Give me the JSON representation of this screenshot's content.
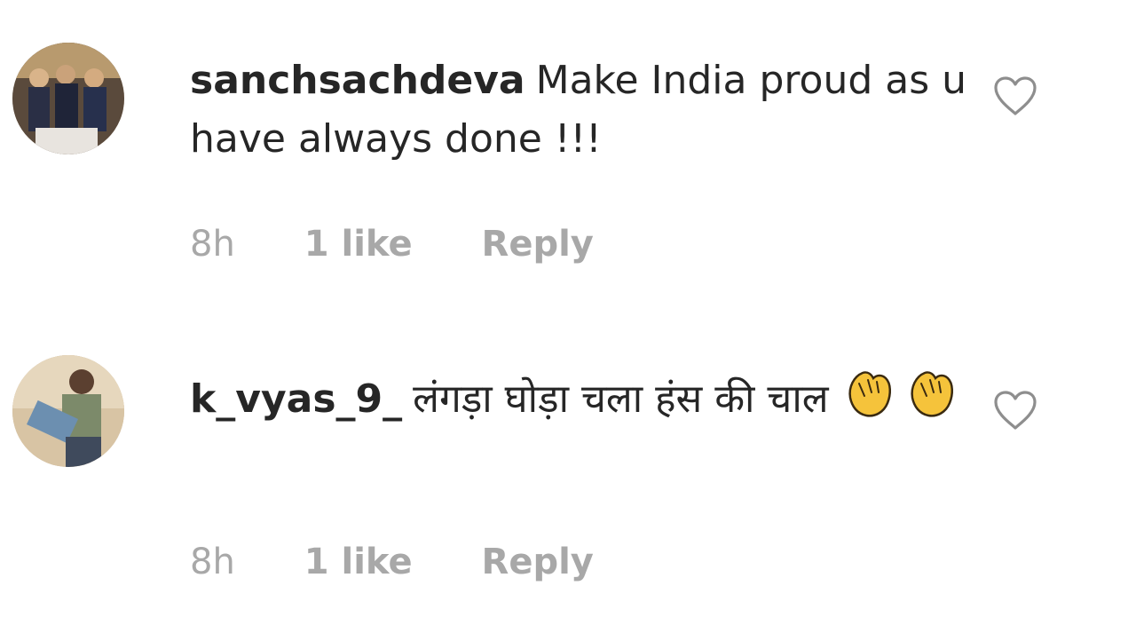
{
  "comments": [
    {
      "username": "sanchsachdeva",
      "text": "Make India proud as u have always done !!!",
      "time": "8h",
      "likes": "1 like",
      "reply": "Reply",
      "avatar_icon": "group-photo-avatar",
      "like_icon": "heart-outline-icon"
    },
    {
      "username": "k_vyas_9_",
      "text": "लंगड़ा घोड़ा चला हंस की चाल",
      "emojis": [
        "clapping-hands",
        "clapping-hands"
      ],
      "time": "8h",
      "likes": "1 like",
      "reply": "Reply",
      "avatar_icon": "person-photo-avatar",
      "like_icon": "heart-outline-icon"
    }
  ],
  "colors": {
    "text": "#262626",
    "meta": "#a8a8a8",
    "heart": "#8e8e8e",
    "background": "#ffffff"
  }
}
